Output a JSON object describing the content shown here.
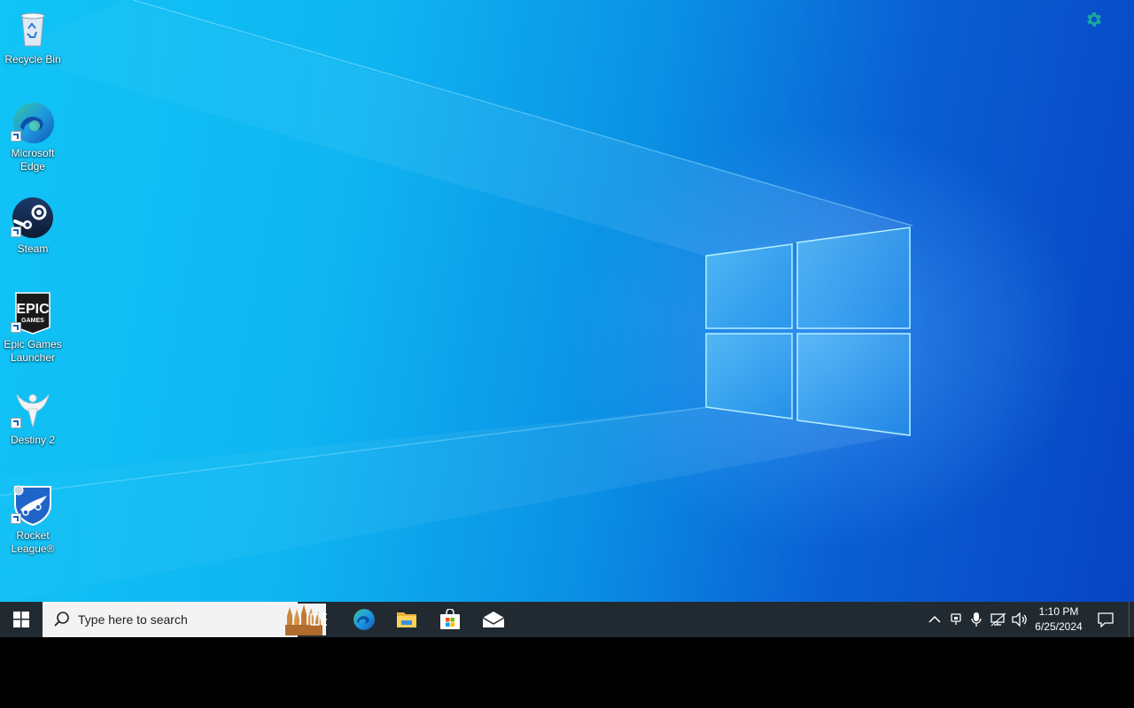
{
  "desktop": {
    "icons": [
      {
        "label": "Recycle Bin",
        "icon": "recycle-bin-icon"
      },
      {
        "label": "Microsoft\nEdge",
        "icon": "edge-icon"
      },
      {
        "label": "Steam",
        "icon": "steam-icon"
      },
      {
        "label": "Epic Games\nLauncher",
        "icon": "epic-games-icon",
        "logo_text": "EPIC GAMES"
      },
      {
        "label": "Destiny 2",
        "icon": "destiny-2-icon"
      },
      {
        "label": "Rocket\nLeague®",
        "icon": "rocket-league-icon"
      }
    ],
    "wallpaper_colors": {
      "light": "#10c4f6",
      "dark": "#0744c3"
    }
  },
  "overlay": {
    "icon": "gear-icon",
    "color": "#17a9a0"
  },
  "taskbar": {
    "start_icon": "windows-start-icon",
    "search_placeholder": "Type here to search",
    "pinned": [
      "task-view-icon",
      "edge-icon",
      "file-explorer-icon",
      "microsoft-store-icon",
      "mail-icon"
    ],
    "tray_icons": [
      "chevron-up-icon",
      "meet-now-icon",
      "microphone-icon",
      "network-icon",
      "volume-icon"
    ],
    "time": "1:10 PM",
    "date": "6/25/2024",
    "notification_icon": "notification-center-icon",
    "background": "#222a31"
  }
}
